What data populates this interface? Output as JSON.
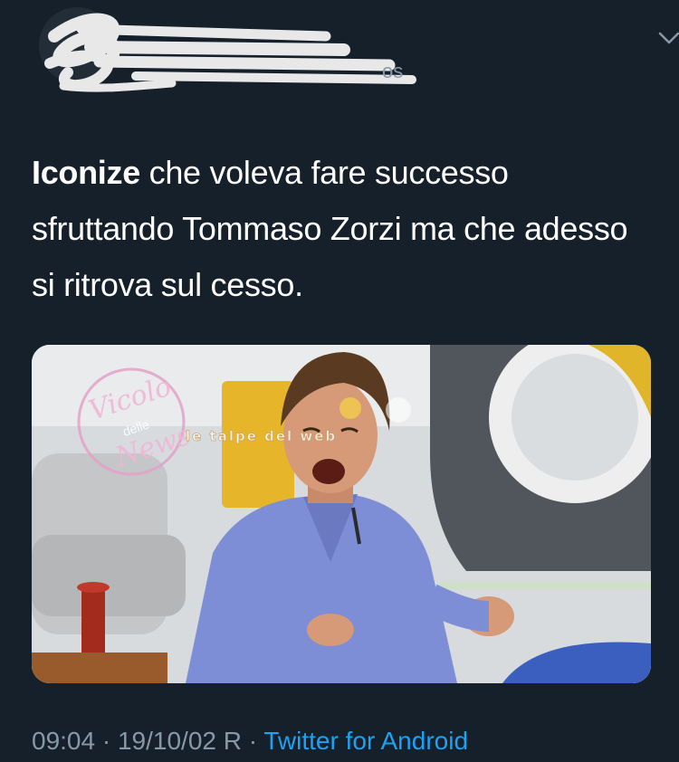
{
  "tweet": {
    "mention": "Iconize",
    "text_rest": " che voleva fare successo sfruttando Tommaso Zorzi ma che adesso si ritrova sul cesso.",
    "time": "09:04",
    "separator": " · ",
    "date": "19/10/02 R",
    "source": "Twitter for Android"
  },
  "media": {
    "watermark_left": {
      "line1": "Vicolo",
      "line2": "delle",
      "line3": "News"
    },
    "watermark_right": "le talpe del web"
  },
  "icons": {
    "more_menu": "chevron-down-icon"
  },
  "colors": {
    "background": "#15202b",
    "text": "#ffffff",
    "secondary_text": "#8899a6",
    "link": "#1da1f2"
  }
}
